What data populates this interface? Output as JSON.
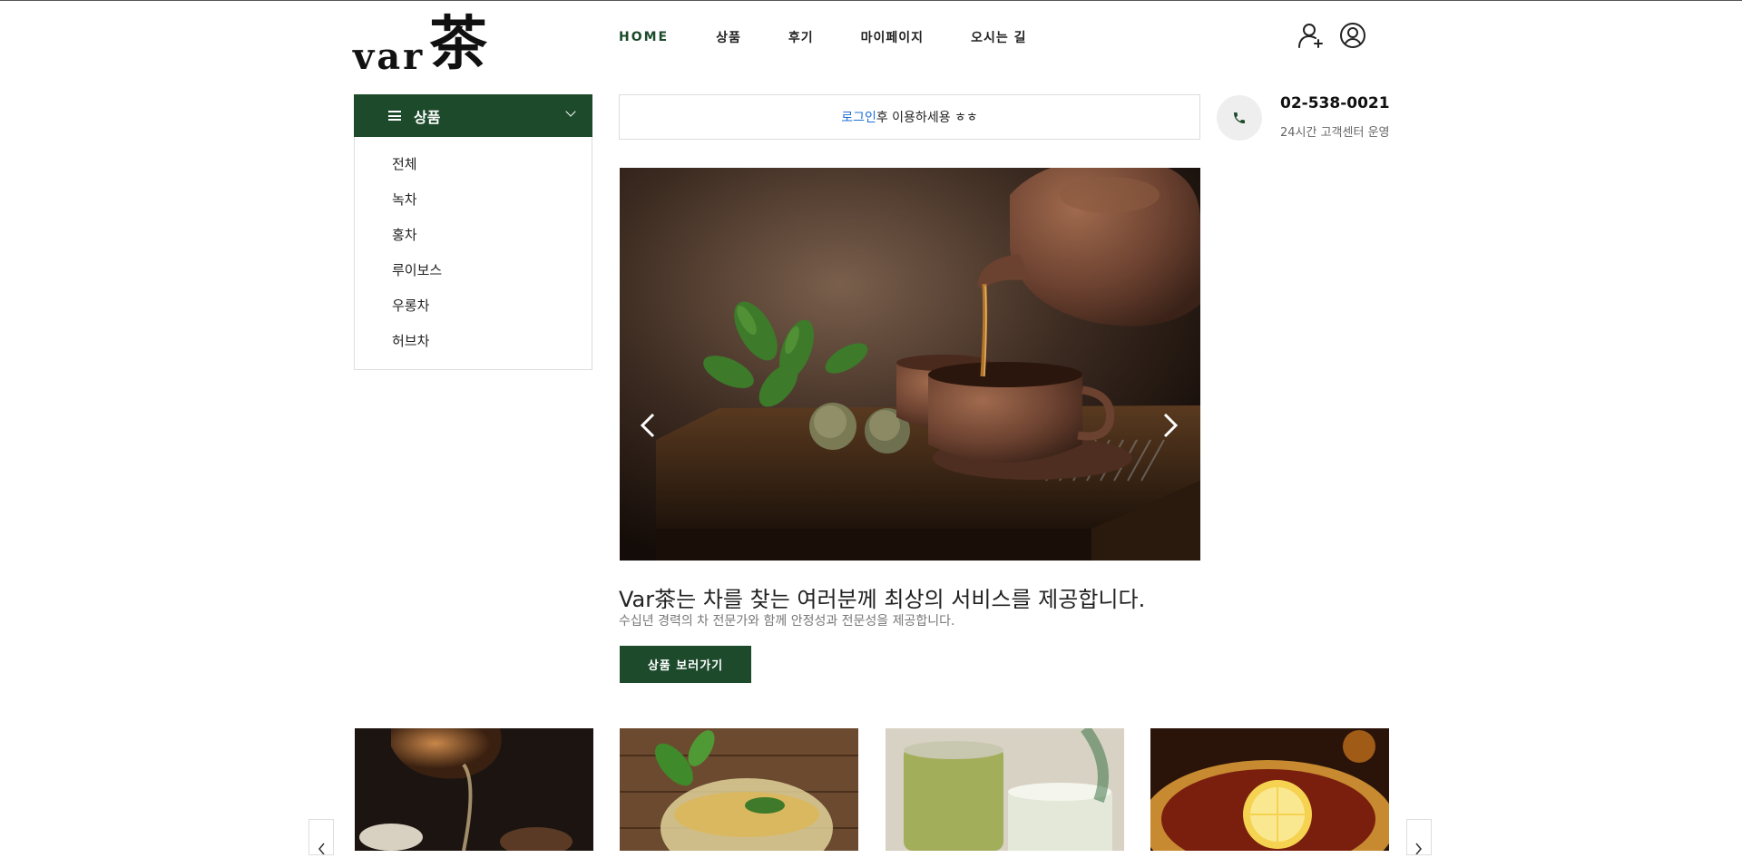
{
  "brand": {
    "latin": "var",
    "hanja": "茶"
  },
  "nav": {
    "items": [
      {
        "label": "HOME",
        "active": true
      },
      {
        "label": "상품"
      },
      {
        "label": "후기"
      },
      {
        "label": "마이페이지"
      },
      {
        "label": "오시는 길"
      }
    ],
    "icons": [
      "add-user-icon",
      "user-account-icon"
    ]
  },
  "category": {
    "title": "상품",
    "items": [
      "전체",
      "녹차",
      "홍차",
      "루이보스",
      "우롱차",
      "허브차"
    ]
  },
  "notice": {
    "link": "로그인",
    "text": "후 이용하세용 ㅎㅎ"
  },
  "contact": {
    "phone": "02-538-0021",
    "hours": "24시간 고객센터 운영"
  },
  "hero": {
    "title": "Var茶는 차를 찾는 여러분께 최상의 서비스를 제공합니다.",
    "subtitle": "수십년 경력의 차 전문가와 함께 안정성과 전문성을 제공합니다.",
    "cta": "상품 보러가기"
  },
  "colors": {
    "brand_green": "#1c4a2b",
    "link_blue": "#1e6fd9"
  },
  "products": [
    {
      "image": "teapot-pouring-photo"
    },
    {
      "image": "herbal-tea-glass-with-mint-photo"
    },
    {
      "image": "green-tea-glasses-photo"
    },
    {
      "image": "black-tea-with-lemon-photo"
    }
  ]
}
